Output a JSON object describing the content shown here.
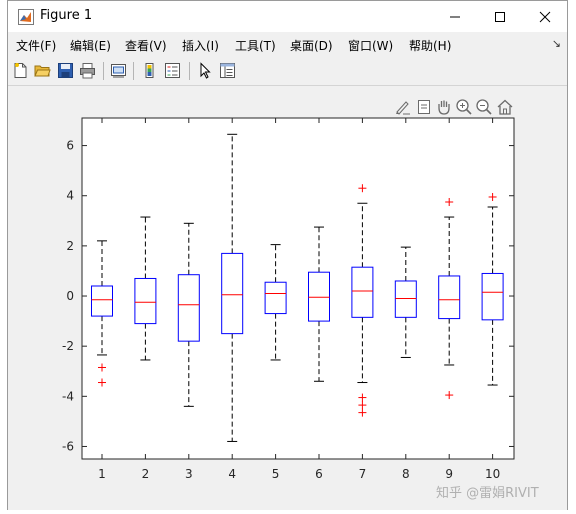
{
  "window": {
    "title": "Figure 1",
    "controls": [
      "minimize",
      "maximize",
      "close"
    ]
  },
  "menu": [
    {
      "label": "文件(F)"
    },
    {
      "label": "编辑(E)"
    },
    {
      "label": "查看(V)"
    },
    {
      "label": "插入(I)"
    },
    {
      "label": "工具(T)"
    },
    {
      "label": "桌面(D)"
    },
    {
      "label": "窗口(W)"
    },
    {
      "label": "帮助(H)"
    }
  ],
  "toolbar": {
    "buttons": [
      "new-figure-icon",
      "open-file-icon",
      "save-icon",
      "print-icon",
      "link-plot-icon",
      "insert-colorbar-icon",
      "insert-legend-icon",
      "edit-plot-arrow-icon",
      "property-inspector-icon"
    ]
  },
  "axes_toolbar": {
    "buttons": [
      "brush-icon",
      "data-tips-icon",
      "pan-icon",
      "zoom-in-icon",
      "zoom-out-icon",
      "home-icon"
    ]
  },
  "watermark": "知乎 @雷娟RIVIT",
  "colors": {
    "box": "#0000ff",
    "median": "#ff0000",
    "whisker": "#000000",
    "outlier": "#ff0000",
    "axes_bg": "#ffffff",
    "figure_bg": "#f0f0f0"
  },
  "chart_data": {
    "type": "boxplot",
    "title": "",
    "xlabel": "",
    "ylabel": "",
    "ylim": [
      -6.5,
      7.1
    ],
    "yticks": [
      -6,
      -4,
      -2,
      0,
      2,
      4,
      6
    ],
    "categories": [
      "1",
      "2",
      "3",
      "4",
      "5",
      "6",
      "7",
      "8",
      "9",
      "10"
    ],
    "boxes": [
      {
        "label": "1",
        "whisker_low": -2.35,
        "q1": -0.8,
        "median": -0.15,
        "q3": 0.4,
        "whisker_high": 2.2,
        "outliers": [
          -2.85,
          -3.45
        ]
      },
      {
        "label": "2",
        "whisker_low": -2.55,
        "q1": -1.1,
        "median": -0.25,
        "q3": 0.7,
        "whisker_high": 3.15,
        "outliers": []
      },
      {
        "label": "3",
        "whisker_low": -4.4,
        "q1": -1.8,
        "median": -0.35,
        "q3": 0.85,
        "whisker_high": 2.9,
        "outliers": []
      },
      {
        "label": "4",
        "whisker_low": -5.8,
        "q1": -1.5,
        "median": 0.05,
        "q3": 1.7,
        "whisker_high": 6.45,
        "outliers": []
      },
      {
        "label": "5",
        "whisker_low": -2.55,
        "q1": -0.7,
        "median": 0.1,
        "q3": 0.55,
        "whisker_high": 2.05,
        "outliers": []
      },
      {
        "label": "6",
        "whisker_low": -3.4,
        "q1": -1.0,
        "median": -0.05,
        "q3": 0.95,
        "whisker_high": 2.75,
        "outliers": []
      },
      {
        "label": "7",
        "whisker_low": -3.45,
        "q1": -0.85,
        "median": 0.2,
        "q3": 1.15,
        "whisker_high": 3.7,
        "outliers": [
          4.3,
          -4.05,
          -4.35,
          -4.65
        ]
      },
      {
        "label": "8",
        "whisker_low": -2.45,
        "q1": -0.85,
        "median": -0.1,
        "q3": 0.6,
        "whisker_high": 1.95,
        "outliers": []
      },
      {
        "label": "9",
        "whisker_low": -2.75,
        "q1": -0.9,
        "median": -0.15,
        "q3": 0.8,
        "whisker_high": 3.15,
        "outliers": [
          3.75,
          -3.95
        ]
      },
      {
        "label": "10",
        "whisker_low": -3.55,
        "q1": -0.95,
        "median": 0.15,
        "q3": 0.9,
        "whisker_high": 3.55,
        "outliers": [
          3.95
        ]
      }
    ]
  }
}
